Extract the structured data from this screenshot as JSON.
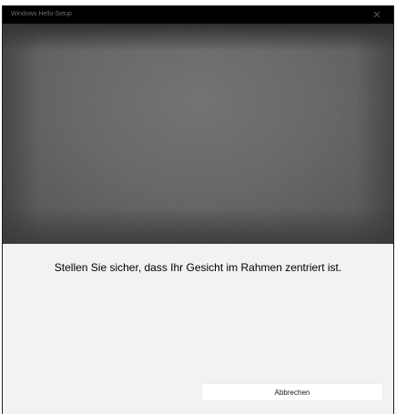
{
  "window": {
    "title": "Windows Hello-Setup"
  },
  "main": {
    "instruction": "Stellen Sie sicher, dass Ihr Gesicht im Rahmen zentriert ist.",
    "cancel_label": "Abbrechen"
  },
  "icons": {
    "close": "close-icon"
  },
  "colors": {
    "titlebar_bg": "#000000",
    "dialog_bg": "#f2f2f2",
    "camera_bg": "#5c5c5c",
    "button_bg": "#ffffff"
  }
}
